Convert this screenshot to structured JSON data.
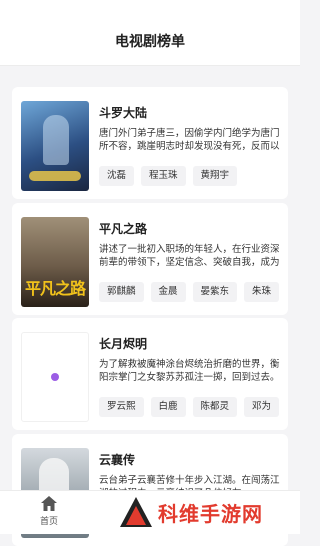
{
  "header": {
    "title": "电视剧榜单"
  },
  "items": [
    {
      "name": "斗罗大陆",
      "desc": "唐门外门弟子唐三，因偷学内门绝学为唐门所不容，跳崖明志时却发现没有死，反而以另外一个身份来到了另一个世界。",
      "cast": [
        "沈磊",
        "程玉珠",
        "黄翔宇"
      ]
    },
    {
      "name": "平凡之路",
      "desc": "讲述了一批初入职场的年轻人，在行业资深前辈的带领下，坚定信念、突破自我，成为优秀律师的故事。",
      "cast": [
        "郭麒麟",
        "金晨",
        "晏紫东",
        "朱珠"
      ],
      "poster_text": "平凡之路"
    },
    {
      "name": "长月烬明",
      "desc": "为了解救被魔神涂台烬统治折磨的世界，衡阳宗掌门之女黎苏苏孤注一掷，回到过去。",
      "cast": [
        "罗云熙",
        "白鹿",
        "陈都灵",
        "邓为"
      ]
    },
    {
      "name": "云襄传",
      "desc": "云台弟子云襄苦修十年步入江湖。在闯荡江湖的过程中，云襄结识了几位好友。",
      "cast": []
    }
  ],
  "tabbar": {
    "home_label": "首页"
  },
  "watermark": {
    "text": "科维手游网"
  }
}
